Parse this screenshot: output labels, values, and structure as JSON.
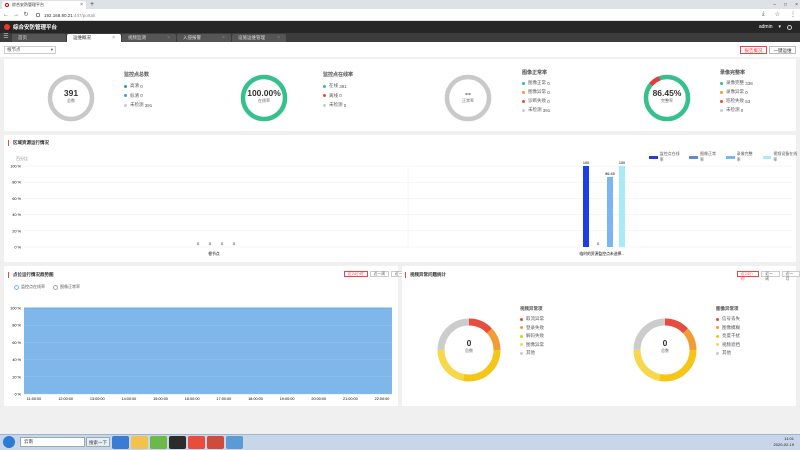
{
  "browser": {
    "tab_title": "综合安防管理平台",
    "url_host": "192.168.80.21",
    "url_path": ":447/portal/"
  },
  "app": {
    "title": "综合安防管理平台",
    "user": "admin"
  },
  "nav": {
    "tabs": [
      {
        "label": "首页"
      },
      {
        "label": "运维概况"
      },
      {
        "label": "视频监测"
      },
      {
        "label": "入侵报警"
      },
      {
        "label": "设施运维管理"
      }
    ]
  },
  "filter": {
    "region": "根节点",
    "query_label": "报告概况",
    "reset_label": "一键运维"
  },
  "stats": {
    "cameras": {
      "title": "监控点总数",
      "value": "391",
      "unit": "总数",
      "items": [
        {
          "label": "高清",
          "value": "0"
        },
        {
          "label": "标清",
          "value": "0"
        },
        {
          "label": "未检测",
          "value": "391"
        }
      ]
    },
    "online": {
      "title": "监控点在线率",
      "value": "100.00%",
      "unit": "在线率",
      "items": [
        {
          "label": "在线",
          "value": "391"
        },
        {
          "label": "离线",
          "value": "0"
        },
        {
          "label": "未检测",
          "value": "0"
        }
      ]
    },
    "image": {
      "title": "图像正常率",
      "value": "--",
      "unit": "正常率",
      "items": [
        {
          "label": "图像正常",
          "value": "0"
        },
        {
          "label": "图像异常",
          "value": "0"
        },
        {
          "label": "诊断失败",
          "value": "0"
        },
        {
          "label": "未检测",
          "value": "391"
        }
      ]
    },
    "recording": {
      "title": "录像完整率",
      "value": "86.45%",
      "unit": "完整率",
      "items": [
        {
          "label": "录像完整",
          "value": "338"
        },
        {
          "label": "录像异常",
          "value": "0"
        },
        {
          "label": "巡检失败",
          "value": "53"
        },
        {
          "label": "未检测",
          "value": "0"
        }
      ]
    }
  },
  "region_panel": {
    "title": "区域资源运行情况",
    "unit_label": "百分比",
    "legend": [
      {
        "label": "监控点在线率",
        "color": "#1f3de6"
      },
      {
        "label": "图像正常率",
        "color": "#5b8dd9"
      },
      {
        "label": "录像完整率",
        "color": "#7bb6f0"
      },
      {
        "label": "视频设备在线率",
        "color": "#a6ecf2"
      }
    ],
    "y_ticks": [
      "100 %",
      "80 %",
      "60 %",
      "40 %",
      "20 %",
      "0 %"
    ],
    "groups": [
      {
        "name": "根节点",
        "values": [
          0,
          0,
          0,
          0
        ]
      },
      {
        "name": "临时的资源监控点未选择...",
        "values": [
          100,
          0,
          86.45,
          100
        ]
      }
    ],
    "labels": [
      "0",
      "0",
      "0",
      "0",
      "100",
      "0",
      "86.45",
      "100"
    ]
  },
  "trend_panel": {
    "title": "点位运行情况趋势图",
    "legend": [
      {
        "label": "监控点在线率",
        "color": "#7bb6f0"
      },
      {
        "label": "图像正常率",
        "color": "#9aa"
      }
    ],
    "buttons": [
      "近24小时",
      "近一周",
      "近一月"
    ],
    "y_ticks": [
      "100 %",
      "80 %",
      "60 %",
      "40 %",
      "20 %",
      "0 %"
    ],
    "x_ticks": [
      "11:00:00",
      "12:00:00",
      "13:00:00",
      "14:00:00",
      "15:00:00",
      "16:00:00",
      "17:00:00",
      "18:00:00",
      "19:00:00",
      "20:00:00",
      "21:00:00",
      "22:00:00"
    ]
  },
  "fault_panel": {
    "title": "视频异常问题统计",
    "buttons": [
      "近24小时",
      "近一周",
      "近一月"
    ],
    "donut1": {
      "value": "0",
      "unit": "总数",
      "title": "视频异常项",
      "items": [
        {
          "label": "取流异常",
          "color": "#e84c3d"
        },
        {
          "label": "登录失败",
          "color": "#f39c33"
        },
        {
          "label": "解码失败",
          "color": "#f5c518"
        },
        {
          "label": "图像异常",
          "color": "#f7d84a"
        },
        {
          "label": "其他",
          "color": "#cccccc"
        }
      ]
    },
    "donut2": {
      "value": "0",
      "unit": "总数",
      "title": "图像异常项",
      "items": [
        {
          "label": "信号丢失",
          "color": "#e84c3d"
        },
        {
          "label": "图像模糊",
          "color": "#f39c33"
        },
        {
          "label": "亮度干扰",
          "color": "#f5c518"
        },
        {
          "label": "视频遮挡",
          "color": "#f7d84a"
        },
        {
          "label": "其他",
          "color": "#cccccc"
        }
      ]
    }
  },
  "taskbar": {
    "search_text": "云南",
    "search_btn": "搜索一下",
    "time": "11:01",
    "date": "2020-02-19"
  }
}
